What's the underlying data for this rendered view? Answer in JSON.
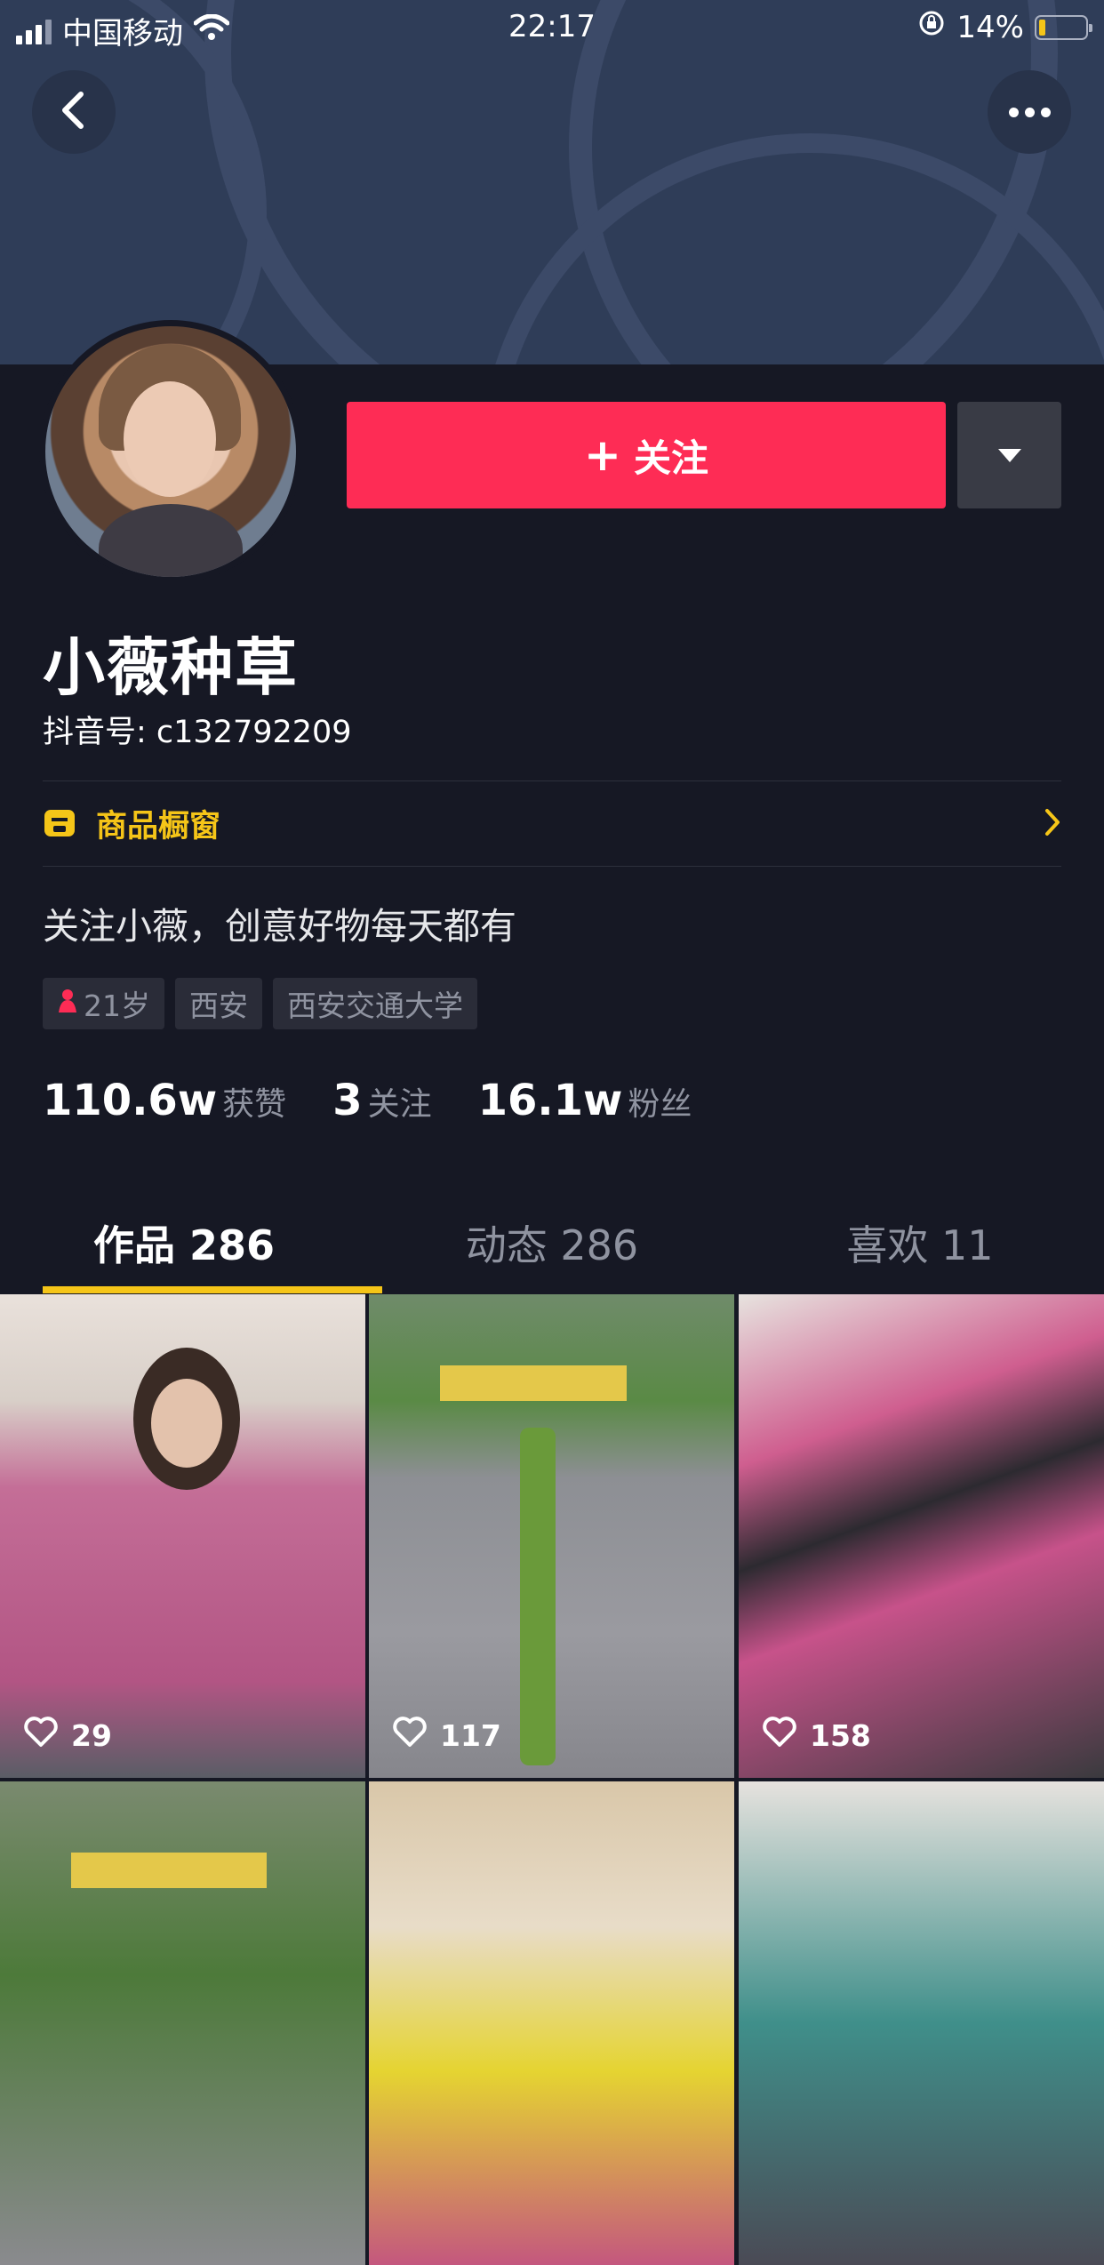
{
  "status_bar": {
    "carrier": "中国移动",
    "time": "22:17",
    "battery": "14%"
  },
  "header": {
    "back_icon": "chevron-left-icon",
    "more_icon": "ellipsis-icon"
  },
  "profile": {
    "follow_label": "关注",
    "name": "小薇种草",
    "douyin_id": "抖音号: c132792209",
    "shop_label": "商品橱窗",
    "bio": "关注小薇，创意好物每天都有",
    "tags": [
      "21岁",
      "西安",
      "西安交通大学"
    ]
  },
  "stats": [
    {
      "value": "110.6w",
      "label": "获赞"
    },
    {
      "value": "3",
      "label": "关注"
    },
    {
      "value": "16.1w",
      "label": "粉丝"
    }
  ],
  "tabs": [
    "作品 286",
    "动态 286",
    "喜欢 11"
  ],
  "videos": [
    {
      "likes": "29"
    },
    {
      "likes": "117"
    },
    {
      "likes": "158"
    },
    {
      "likes": ""
    },
    {
      "likes": ""
    },
    {
      "likes": ""
    }
  ],
  "colors": {
    "accent": "#fe2c55",
    "gold": "#f5c518",
    "background": "#161824"
  }
}
